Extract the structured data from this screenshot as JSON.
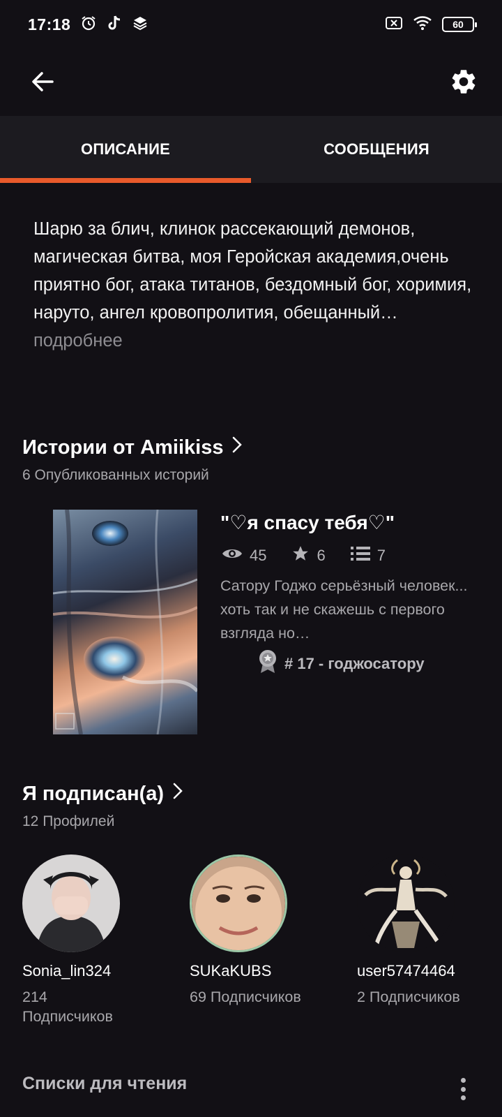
{
  "status_bar": {
    "time": "17:18",
    "battery": "60",
    "icons": [
      "alarm-icon",
      "tiktok-icon",
      "layers-icon",
      "no-sim-icon",
      "wifi-icon",
      "battery-icon"
    ]
  },
  "app_bar": {
    "back_icon": "arrow-left-icon",
    "settings_icon": "gear-icon"
  },
  "tabs": [
    {
      "label": "ОПИСАНИЕ",
      "active": true
    },
    {
      "label": "СООБЩЕНИЯ",
      "active": false
    }
  ],
  "colors": {
    "background": "#121015",
    "tab_bar": "#1c1b20",
    "accent": "#e85a2b",
    "muted_text": "#a8a7ab"
  },
  "description": {
    "text": "Шарю за блич, клинок рассекающий демонов, магическая битва, моя Геройская академия,очень приятно бог, атака титанов, бездомный бог, хоримия, наруто, ангел кровопролития, обещанный…",
    "more": " подробнее"
  },
  "stories": {
    "title": "Истории от Amiikiss",
    "subtitle": "6 Опубликованных историй",
    "items": [
      {
        "title": "\"♡я спасу тебя♡\"",
        "reads": "45",
        "votes": "6",
        "parts": "7",
        "description": "Сатору Годжо серьёзный человек... хоть так и не скажешь с первого взгляда но…",
        "tag": "# 17 - годжосатору"
      }
    ]
  },
  "following": {
    "title": "Я подписан(а)",
    "subtitle": "12 Профилей",
    "profiles": [
      {
        "name": "Sonia_lin324",
        "followers": "214 Подписчиков"
      },
      {
        "name": "SUKaKUBS",
        "followers": "69 Подписчиков"
      },
      {
        "name": "user57474464",
        "followers": "2 Подписчиков"
      }
    ]
  },
  "reading_lists": {
    "title": "Списки для чтения",
    "menu_icon": "more-vertical-icon"
  }
}
